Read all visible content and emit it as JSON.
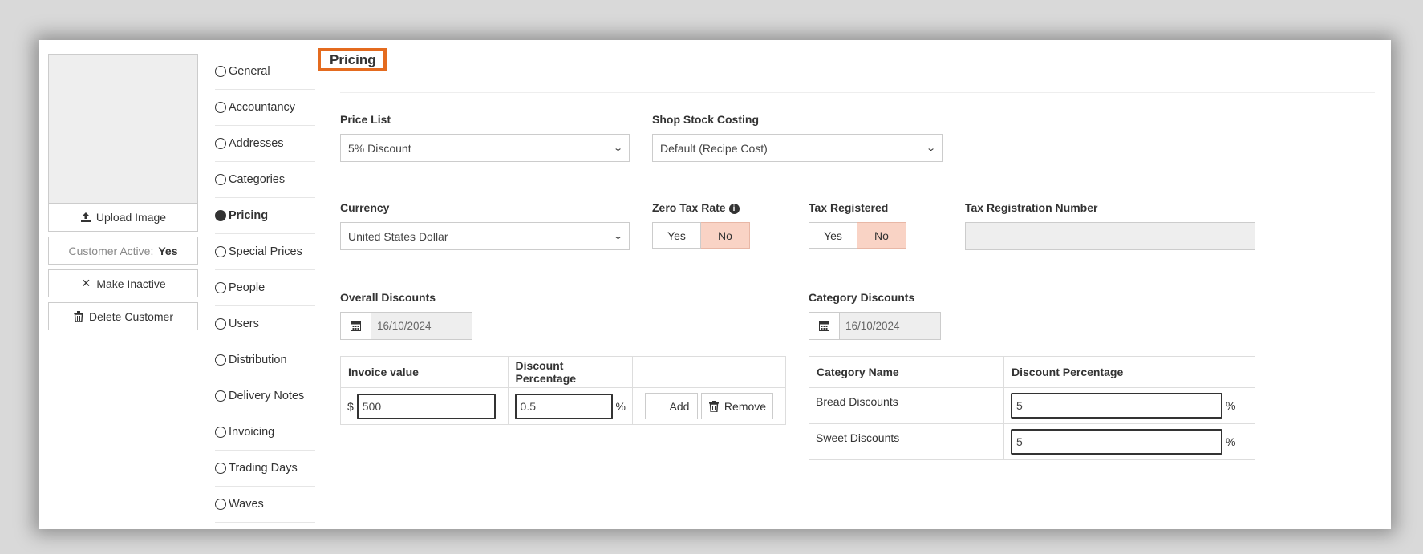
{
  "sidebar": {
    "upload_label": "Upload Image",
    "status_label": "Customer Active:",
    "status_value": "Yes",
    "make_inactive_label": "Make Inactive",
    "delete_label": "Delete Customer"
  },
  "nav": {
    "items": [
      {
        "label": "General"
      },
      {
        "label": "Accountancy"
      },
      {
        "label": "Addresses"
      },
      {
        "label": "Categories"
      },
      {
        "label": "Pricing",
        "active": true
      },
      {
        "label": "Special Prices"
      },
      {
        "label": "People"
      },
      {
        "label": "Users"
      },
      {
        "label": "Distribution"
      },
      {
        "label": "Delivery Notes"
      },
      {
        "label": "Invoicing"
      },
      {
        "label": "Trading Days"
      },
      {
        "label": "Waves"
      }
    ]
  },
  "page": {
    "title": "Pricing"
  },
  "pricing": {
    "price_list_label": "Price List",
    "price_list_value": "5% Discount",
    "shop_stock_label": "Shop Stock Costing",
    "shop_stock_value": "Default (Recipe Cost)",
    "currency_label": "Currency",
    "currency_value": "United States Dollar",
    "zero_tax_label": "Zero Tax Rate",
    "zero_tax_yes": "Yes",
    "zero_tax_no": "No",
    "zero_tax_selected": "No",
    "tax_registered_label": "Tax Registered",
    "tax_registered_yes": "Yes",
    "tax_registered_no": "No",
    "tax_registered_selected": "No",
    "tax_reg_number_label": "Tax Registration Number",
    "tax_reg_number_value": ""
  },
  "overall_discounts": {
    "label": "Overall Discounts",
    "date": "16/10/2024",
    "headers": [
      "Invoice value",
      "Discount Percentage",
      ""
    ],
    "currency_symbol": "$",
    "invoice_value": "500",
    "discount_pct": "0.5",
    "pct_symbol": "%",
    "add_label": "Add",
    "remove_label": "Remove"
  },
  "category_discounts": {
    "label": "Category Discounts",
    "date": "16/10/2024",
    "headers": [
      "Category Name",
      "Discount Percentage"
    ],
    "pct_symbol": "%",
    "rows": [
      {
        "name": "Bread Discounts",
        "value": "5"
      },
      {
        "name": "Sweet Discounts",
        "value": "5"
      }
    ]
  }
}
